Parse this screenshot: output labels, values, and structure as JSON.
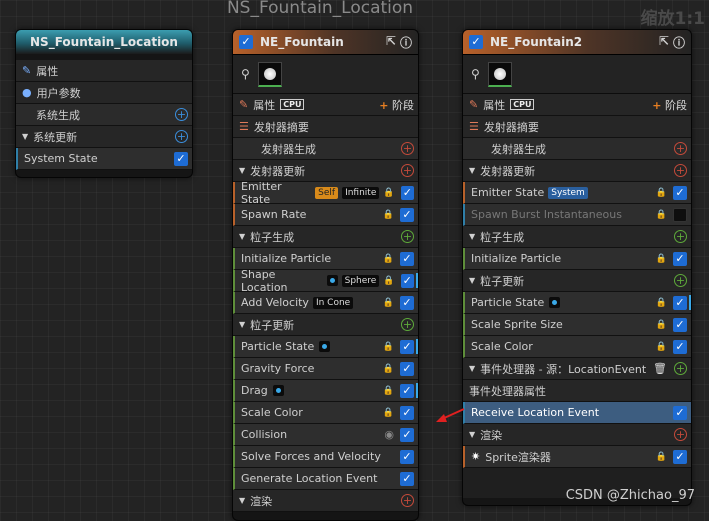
{
  "graph_title": "NS_Fountain_Location",
  "zoom": "缩放1:1",
  "watermark": "CSDN @Zhichao_97",
  "system_node": {
    "title": "NS_Fountain_Location",
    "rows": {
      "properties": "属性",
      "user_params": "用户参数",
      "system_spawn": "系统生成",
      "system_update": "系统更新",
      "system_state": "System State"
    }
  },
  "emitter1": {
    "title": "NE_Fountain",
    "properties": "属性",
    "cpu": "CPU",
    "stage": "阶段",
    "summary": "发射器摘要",
    "emitter_spawn": "发射器生成",
    "emitter_update": "发射器更新",
    "emitter_state": "Emitter State",
    "badge_self": "Self",
    "badge_infinite": "Infinite",
    "spawn_rate": "Spawn Rate",
    "particle_spawn": "粒子生成",
    "init_particle": "Initialize Particle",
    "shape_location": "Shape Location",
    "badge_sphere": "Sphere",
    "add_velocity": "Add Velocity",
    "badge_in_cone": "In Cone",
    "particle_update": "粒子更新",
    "particle_state": "Particle State",
    "gravity_force": "Gravity Force",
    "drag": "Drag",
    "scale_color": "Scale Color",
    "collision": "Collision",
    "solve_forces": "Solve Forces and Velocity",
    "generate_location_event": "Generate Location Event",
    "render": "渲染"
  },
  "emitter2": {
    "title": "NE_Fountain2",
    "properties": "属性",
    "cpu": "CPU",
    "stage": "阶段",
    "summary": "发射器摘要",
    "emitter_spawn": "发射器生成",
    "emitter_update": "发射器更新",
    "emitter_state": "Emitter State",
    "badge_system": "System",
    "spawn_burst": "Spawn Burst Instantaneous",
    "particle_spawn": "粒子生成",
    "init_particle": "Initialize Particle",
    "particle_update": "粒子更新",
    "particle_state": "Particle State",
    "scale_sprite_size": "Scale Sprite Size",
    "scale_color": "Scale Color",
    "event_handler": "事件处理器 - 源：LocationEvent",
    "event_handler_props": "事件处理器属性",
    "receive_location_event": "Receive Location Event",
    "render": "渲染",
    "sprite_renderer": "Sprite渲染器"
  },
  "colors": {
    "accent_blue": "#1e6cd4",
    "header_teal": "#3b9db0",
    "header_orange": "#b8612a",
    "arrow_red": "#e02020"
  }
}
